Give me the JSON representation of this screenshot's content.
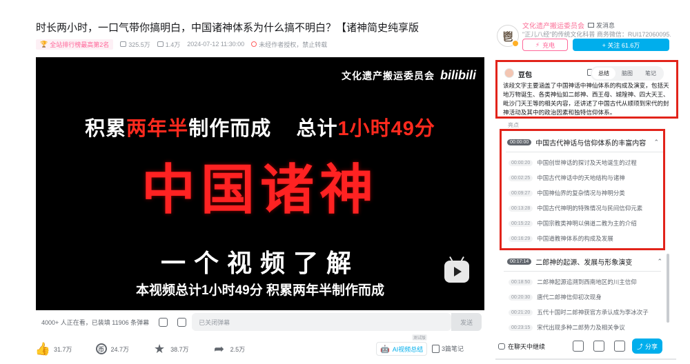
{
  "video": {
    "title": "时长两小时，一口气带你搞明白，中国诸神体系为什么搞不明白？【诸神简史纯享版",
    "rank_badge": "全站排行榜最高第2名",
    "plays": "325.5万",
    "danmaku_count": "1.4万",
    "datetime": "2024-07-12 11:30:00",
    "copyright_note": "未经作者授权，禁止转载"
  },
  "player": {
    "channel_label": "文化遗产搬运委员会",
    "logo_text": "bilibili",
    "line1_prefix": "积累",
    "line1_red": "两年半",
    "line1_mid": "制作而成",
    "line1_total": "总计",
    "line1_red2": "1小时49分",
    "big_title": "中国诸神",
    "line3": "一个视频了解",
    "line4": "本视频总计1小时49分 积累两年半制作而成"
  },
  "danmaku_bar": {
    "viewers": "4000+ 人正在看，已装填 11906 条弹幕",
    "input_placeholder": "已关闭弹幕",
    "send_label": "发送"
  },
  "actions": {
    "like": "31.7万",
    "coin": "24.7万",
    "favorite": "38.7万",
    "share": "2.5万",
    "ai_summary_label": "AI视频总结",
    "ai_tag": "测试版",
    "notes_label": "3篇笔记"
  },
  "uploader": {
    "avatar_char": "鬯",
    "name": "文化遗产搬运委员会",
    "message_label": "发消息",
    "description": "\"正儿八经\"的传统文化科普 商务微信：RUI172060095...",
    "charge_label": "充电",
    "follow_label": "+ 关注 61.6万"
  },
  "ai_panel": {
    "bot_name": "豆包",
    "tabs": [
      "总结",
      "脑图",
      "笔记"
    ],
    "summary": "该段文字主要涵盖了中国神话中神仙体系的构成及演变，包括天地万物诞生、各类神仙如二郎神、西王母、城隍神、四大天王、毗沙门天王等的相关内容，还讲述了中国古代从顺顼到宋代的封神活动及其中的政治因素和独特信仰体系。"
  },
  "highlights": {
    "label": "亮点",
    "sections": [
      {
        "ts": "00:00:00",
        "title": "中国古代神话与信仰体系的丰富内容",
        "items": [
          {
            "ts": "00:00:20",
            "text": "中国创世神话的探讨及天地诞生的过程"
          },
          {
            "ts": "00:02:25",
            "text": "中国古代神话中的天地结构与诸神"
          },
          {
            "ts": "00:09:27",
            "text": "中国神仙界的复杂情况与神明分类"
          },
          {
            "ts": "00:13:28",
            "text": "中国古代神明的特殊情况与民间信仰元素"
          },
          {
            "ts": "00:15:22",
            "text": "中国宗教类神明以佛道二教为主的介绍"
          },
          {
            "ts": "00:16:29",
            "text": "中国道教神体系的构成及发展"
          }
        ]
      },
      {
        "ts": "00:17:14",
        "title": "二郎神的起源、发展与形象演变",
        "items": [
          {
            "ts": "00:18:50",
            "text": "二郎神起源追溯到西南地区的川主信仰"
          },
          {
            "ts": "00:20:30",
            "text": "唐代二郎神信仰初次现身"
          },
          {
            "ts": "00:21:20",
            "text": "五代十国时二郎神获官方承认成为李冰次子"
          },
          {
            "ts": "00:23:15",
            "text": "宋代出现多种二郎势力及相关争议"
          }
        ]
      }
    ]
  },
  "bottom_bar": {
    "chat_continue": "在聊天中继续",
    "share_label": "分享"
  },
  "colors": {
    "accent_blue": "#00aeec",
    "accent_pink": "#ff6699",
    "highlight_red": "#e2231a",
    "video_red": "#ff2222"
  }
}
